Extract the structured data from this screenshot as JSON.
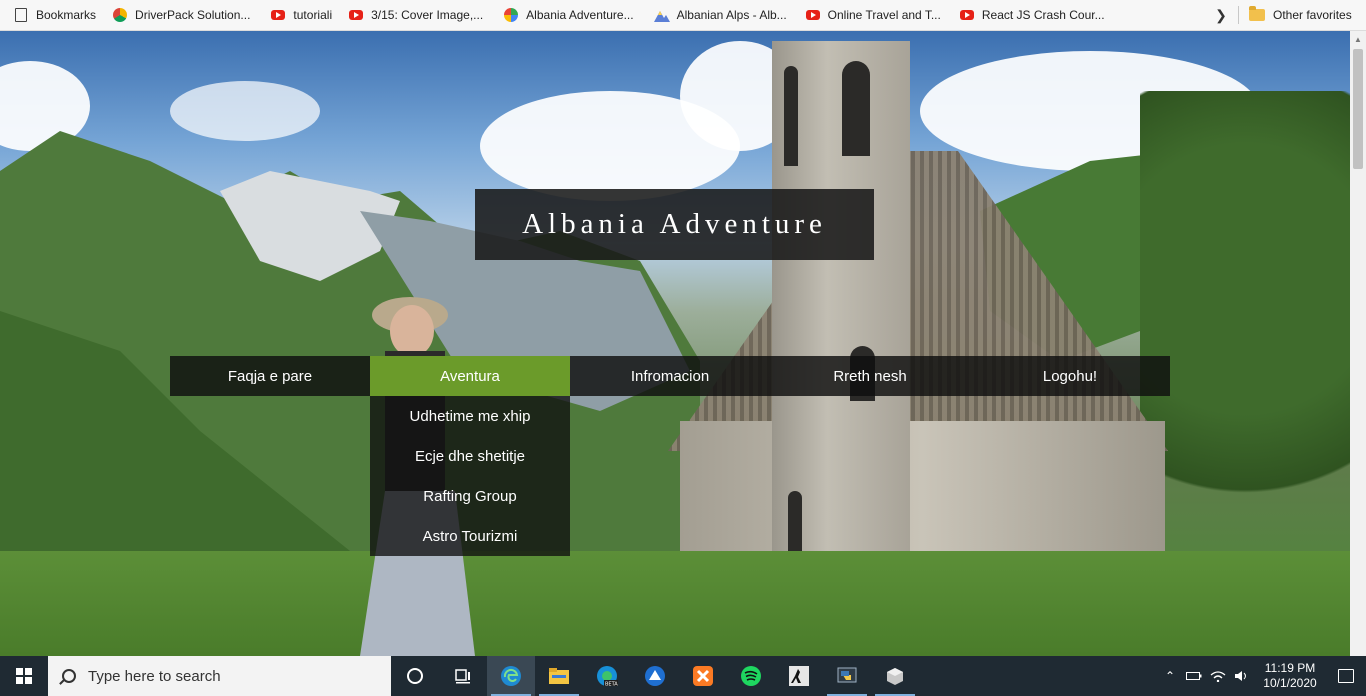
{
  "bookmarks": {
    "items": [
      {
        "label": "Bookmarks",
        "icon": "bookmark-page-icon"
      },
      {
        "label": "DriverPack Solution...",
        "icon": "driverpack-icon"
      },
      {
        "label": "tutoriali",
        "icon": "youtube-icon"
      },
      {
        "label": "3/15: Cover Image,...",
        "icon": "youtube-icon"
      },
      {
        "label": "Albania Adventure...",
        "icon": "globe-icon"
      },
      {
        "label": "Albanian Alps - Alb...",
        "icon": "mountain-icon"
      },
      {
        "label": "Online Travel and T...",
        "icon": "youtube-icon"
      },
      {
        "label": "React JS Crash Cour...",
        "icon": "youtube-icon"
      }
    ],
    "overflow_icon": "chevron-right-icon",
    "other_favorites": "Other favorites"
  },
  "site": {
    "title": "Albania Adventure",
    "accent_color": "#6b9b2a",
    "nav": [
      {
        "label": "Faqja e pare",
        "active": false
      },
      {
        "label": "Aventura",
        "active": true
      },
      {
        "label": "Infromacion",
        "active": false
      },
      {
        "label": "Rreth nesh",
        "active": false
      },
      {
        "label": "Logohu!",
        "active": false
      }
    ],
    "dropdown": [
      "Udhetime me xhip",
      "Ecje dhe shetitje",
      "Rafting Group",
      "Astro Tourizmi"
    ]
  },
  "taskbar": {
    "search_placeholder": "Type here to search",
    "apps": [
      "cortana-icon",
      "task-view-icon",
      "edge-icon",
      "file-explorer-icon",
      "edge-beta-icon",
      "app-icon",
      "xampp-icon",
      "spotify-icon",
      "counter-strike-icon",
      "python-icon",
      "app-cube-icon"
    ],
    "time": "11:19 PM",
    "date": "10/1/2020"
  }
}
